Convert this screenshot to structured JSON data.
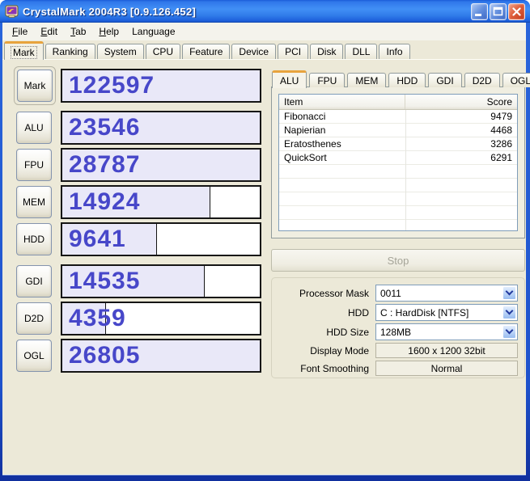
{
  "window": {
    "title": "CrystalMark 2004R3 [0.9.126.452]"
  },
  "menu": {
    "items": [
      "File",
      "Edit",
      "Tab",
      "Help",
      "Language"
    ]
  },
  "main_tabs": {
    "selected": "Mark",
    "items": [
      "Mark",
      "Ranking",
      "System",
      "CPU",
      "Feature",
      "Device",
      "PCI",
      "Disk",
      "DLL",
      "Info"
    ]
  },
  "benchmark": {
    "rows": [
      {
        "label": "Mark",
        "score": "122597",
        "fill_pct": 100
      },
      {
        "label": "ALU",
        "score": "23546",
        "fill_pct": 100
      },
      {
        "label": "FPU",
        "score": "28787",
        "fill_pct": 100
      },
      {
        "label": "MEM",
        "score": "14924",
        "fill_pct": 75
      },
      {
        "label": "HDD",
        "score": "9641",
        "fill_pct": 48
      },
      {
        "label": "GDI",
        "score": "14535",
        "fill_pct": 72
      },
      {
        "label": "D2D",
        "score": "4359",
        "fill_pct": 22
      },
      {
        "label": "OGL",
        "score": "26805",
        "fill_pct": 100
      }
    ]
  },
  "detail": {
    "selected": "ALU",
    "tabs": [
      "ALU",
      "FPU",
      "MEM",
      "HDD",
      "GDI",
      "D2D",
      "OGL"
    ],
    "table": {
      "header_item": "Item",
      "header_score": "Score",
      "rows": [
        {
          "item": "Fibonacci",
          "score": "9479"
        },
        {
          "item": "Napierian",
          "score": "4468"
        },
        {
          "item": "Eratosthenes",
          "score": "3286"
        },
        {
          "item": "QuickSort",
          "score": "6291"
        }
      ]
    }
  },
  "actions": {
    "stop_label": "Stop"
  },
  "settings": {
    "rows": [
      {
        "label": "Processor Mask",
        "value": "0011"
      },
      {
        "label": "HDD",
        "value": "C : HardDisk [NTFS]"
      },
      {
        "label": "HDD Size",
        "value": "128MB"
      },
      {
        "label": "Display Mode",
        "value": "1600 x 1200 32bit"
      },
      {
        "label": "Font Smoothing",
        "value": "Normal"
      }
    ]
  },
  "colors": {
    "titlebar_blue": "#2F7BE9",
    "window_border_blue": "#1E52CC",
    "client_beige": "#ECE9D8",
    "score_text": "#4747C9",
    "score_fill_lavender": "#E9E8F8",
    "selected_tab_stripe": "#E8A33D",
    "close_button_red": "#E0603C"
  }
}
